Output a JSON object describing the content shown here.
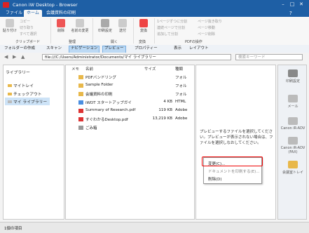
{
  "window": {
    "title": "Canon iW Desktop - Browser"
  },
  "menubar": {
    "tabs": [
      "ファイル",
      "ホーム",
      "会議資料の印刷"
    ],
    "active_index": 1
  },
  "ribbon": {
    "paste": "貼り付け",
    "copy": "コピー",
    "cut": "切り取り",
    "select_all": "すべて選択",
    "delete": "削除",
    "rename": "名前の変更",
    "print_settings": "印刷設定",
    "open": "送付",
    "convert": "変換",
    "pdf_ops": [
      "1ページずつに分割",
      "連続ページで分割",
      "追加して分割",
      "ページ抜き取り",
      "ページ移動",
      "ページ削除"
    ],
    "groups": [
      "クリップボード",
      "整理",
      "開く",
      "変換",
      "PDFの操作"
    ]
  },
  "toolbar": {
    "new_folder": "フォルダーの作成",
    "scan": "スキャン",
    "navigation": "ナビゲーション",
    "preview": "プレビュー",
    "properties": "プロパティー",
    "view": "表示",
    "layout": "レイアウト"
  },
  "address": {
    "path": "file:///C:/Users/Administrator/Documents/マイ ライブラリー",
    "search_placeholder": "検索キーワード"
  },
  "left": {
    "label": "ライブラリー",
    "items": [
      "マイトレイ",
      "チェックアウト",
      "マイ ライブラリー"
    ]
  },
  "filelist": {
    "columns": {
      "memo": "メモ",
      "name": "名前",
      "size": "サイズ",
      "type": "種類"
    },
    "rows": [
      {
        "name": "PDFバンドリング",
        "size": "",
        "type": "フォル"
      },
      {
        "name": "Sample Folder",
        "size": "",
        "type": "フォル"
      },
      {
        "name": "会議資料の印刷",
        "size": "",
        "type": "フォル"
      },
      {
        "name": "iWDT スタートアップガイ",
        "size": "4 KB",
        "type": "HTML"
      },
      {
        "name": "Summary of Research.pdf",
        "size": "119 KB",
        "type": "Adobe"
      },
      {
        "name": "すぐわかるDesktop.pdf",
        "size": "13,219 KB",
        "type": "Adobe"
      },
      {
        "name": "ごみ箱",
        "size": "",
        "type": ""
      }
    ]
  },
  "preview": {
    "message": "プレビューするファイルを選択してください。プレビューが表示されない場合は、ファイルを選択しなおしてください。"
  },
  "context_menu": {
    "items": [
      "変更(C)...",
      "ドキュメントを印刷する(E)...",
      "削除(D)"
    ]
  },
  "right": {
    "items": [
      "印刷設定",
      "メール",
      "Canon iR-ADV",
      "Canon iR-ADV (FAX)",
      "会議室トレイ"
    ]
  },
  "status": {
    "text": "1個の項目"
  },
  "colors": {
    "titlebar": "#1e5fa5",
    "accent": "#e00000",
    "folder": "#e8b84a"
  }
}
